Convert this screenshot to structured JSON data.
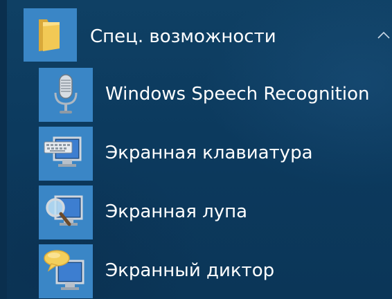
{
  "group": {
    "label": "Спец. возможности",
    "icon": "folder-icon",
    "expanded": true
  },
  "items": [
    {
      "label": "Windows Speech Recognition",
      "icon": "microphone-icon"
    },
    {
      "label": "Экранная клавиатура",
      "icon": "onscreen-keyboard-icon"
    },
    {
      "label": "Экранная лупа",
      "icon": "magnifier-icon"
    },
    {
      "label": "Экранный диктор",
      "icon": "narrator-icon"
    }
  ],
  "colors": {
    "background": "#0c3a5e",
    "tile": "#3a86c6",
    "text": "#ffffff"
  }
}
